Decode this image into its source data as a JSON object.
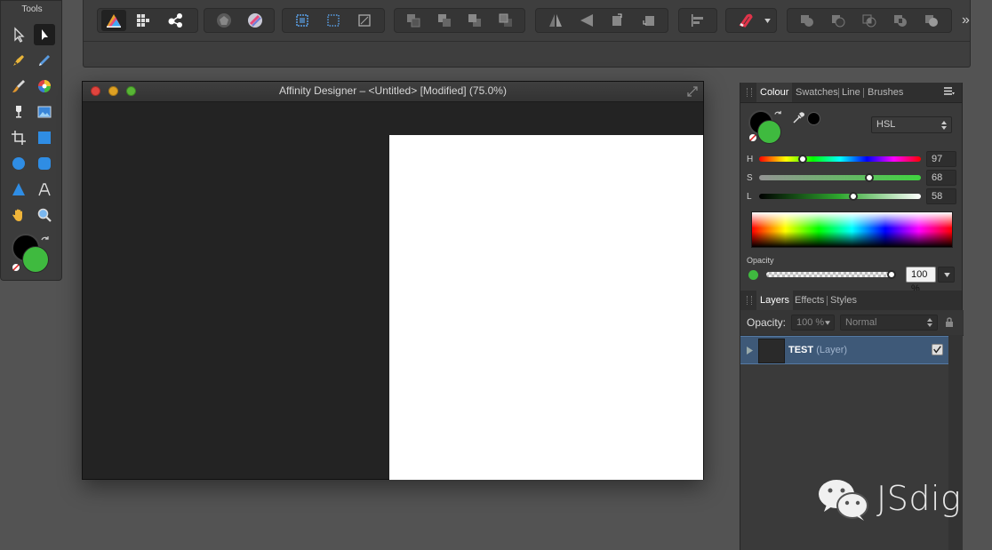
{
  "tools_panel": {
    "title": "Tools"
  },
  "document": {
    "window_title": "Affinity Designer – <Untitled> [Modified] (75.0%)"
  },
  "colour_panel": {
    "tabs": [
      "Colour",
      "Swatches",
      "Line",
      "Brushes"
    ],
    "active_tab": "Colour",
    "mode_select": "HSL",
    "sliders": [
      {
        "label": "H",
        "value": "97",
        "fraction": 0.27
      },
      {
        "label": "S",
        "value": "68",
        "fraction": 0.68
      },
      {
        "label": "L",
        "value": "58",
        "fraction": 0.58
      }
    ],
    "opacity_label": "Opacity",
    "opacity_value": "100 %",
    "fill_color": "#3fba3f",
    "stroke_color": "#000000"
  },
  "layers_panel": {
    "tabs": [
      "Layers",
      "Effects",
      "Styles"
    ],
    "active_tab": "Layers",
    "opacity_label": "Opacity:",
    "opacity_value": "100 %",
    "blend_mode": "Normal",
    "layers": [
      {
        "name": "TEST",
        "type": "(Layer)",
        "visible": true
      }
    ]
  },
  "watermark": {
    "text": "JSdig"
  }
}
